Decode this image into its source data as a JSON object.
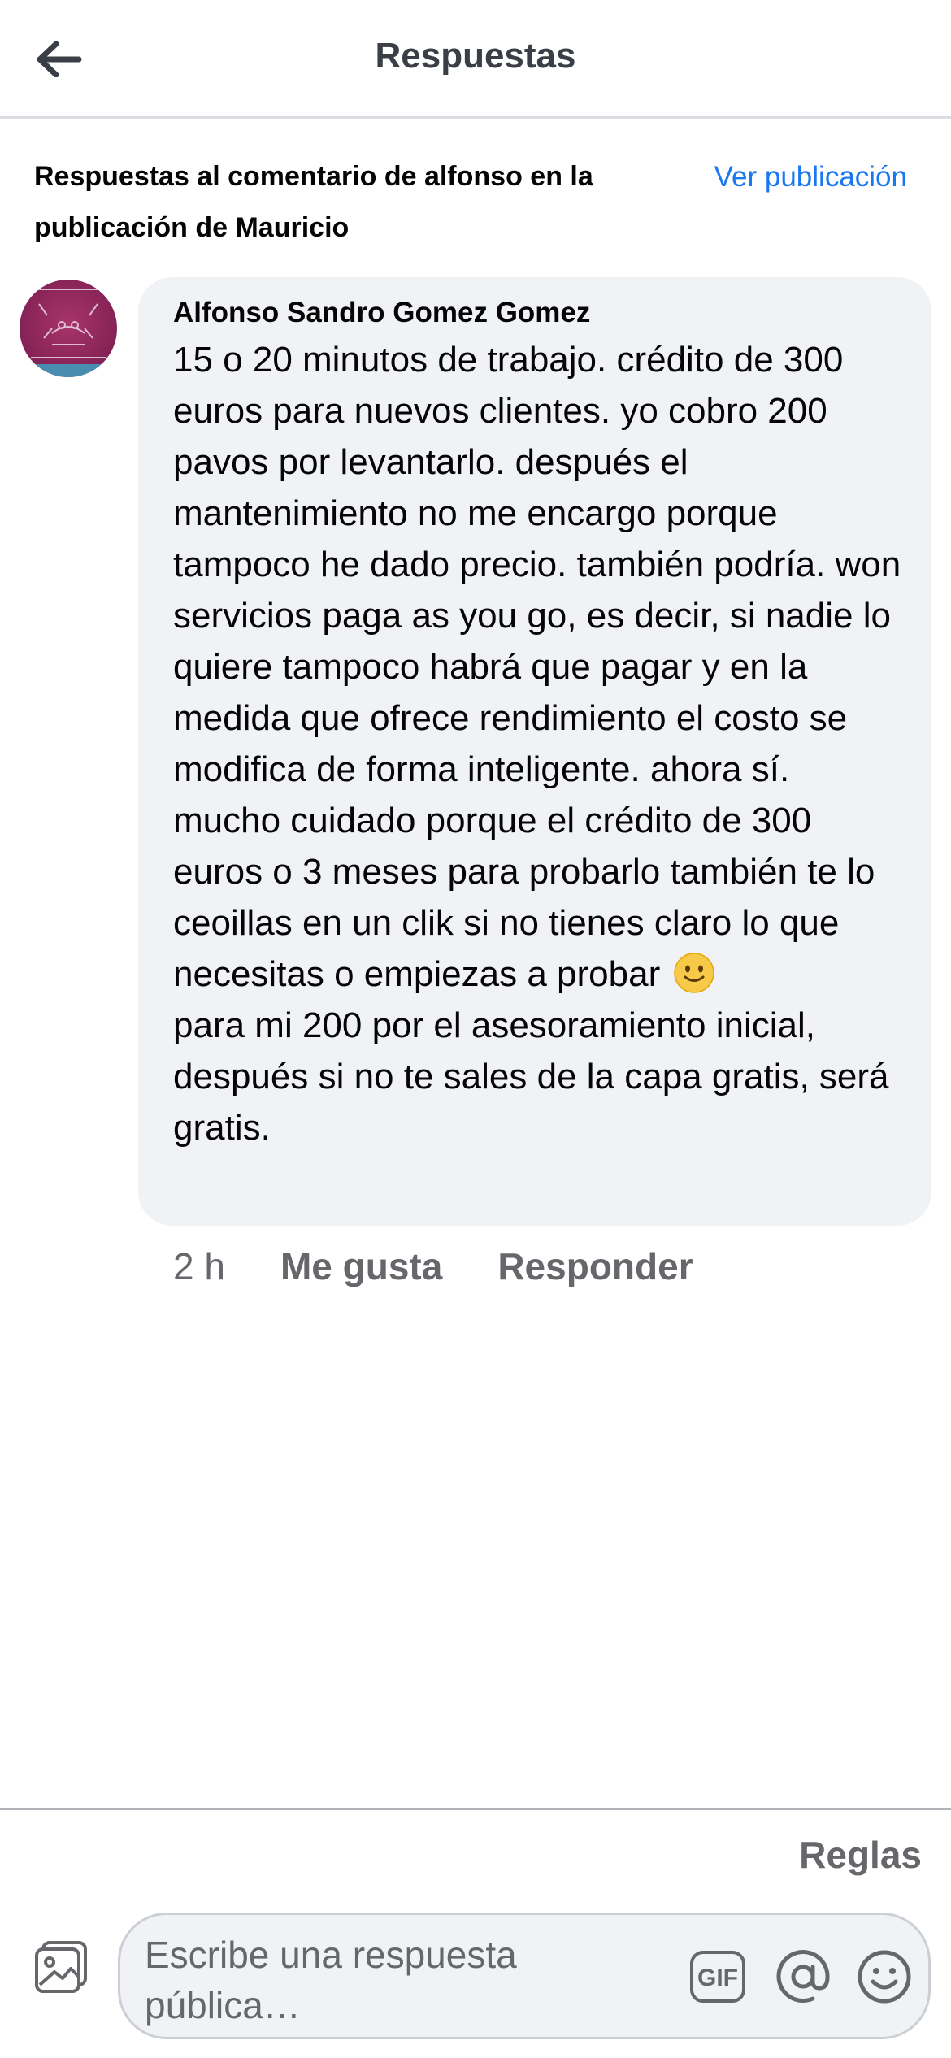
{
  "header": {
    "title": "Respuestas"
  },
  "context": {
    "text": "Respuestas al comentario de alfonso en la publicación de Mauricio",
    "link_label": "Ver publicación"
  },
  "comment": {
    "author": "Alfonso Sandro Gomez Gomez",
    "avatar_icon": "avatar-ascii-art",
    "body_part1": "15 o 20 minutos de trabajo. crédito de 300 euros para nuevos clientes. yo cobro 200 pavos por levantarlo. después el mantenimiento no me encargo porque tampoco he dado precio. también podría. won servicios paga as you go, es decir, si nadie lo quiere tampoco habrá que pagar y en la medida que ofrece rendimiento el costo se modifica de forma inteligente. ahora sí. mucho cuidado porque el crédito de 300 euros o 3 meses para probarlo también te lo ceoillas en un clik si no tienes claro lo que necesitas o empiezas a probar",
    "emoji_icon": "slightly-smiling-face-icon",
    "body_part2": "para mi 200 por el asesoramiento inicial, después si no te sales de la capa gratis, será gratis.",
    "time": "2 h",
    "like_label": "Me gusta",
    "reply_label": "Responder"
  },
  "composer": {
    "rules_label": "Reglas",
    "placeholder": "Escribe una respuesta pública…",
    "gif_label": "GIF"
  },
  "colors": {
    "link": "#1877f2",
    "bubble": "#f0f2f5",
    "secondary_text": "#65676b"
  }
}
